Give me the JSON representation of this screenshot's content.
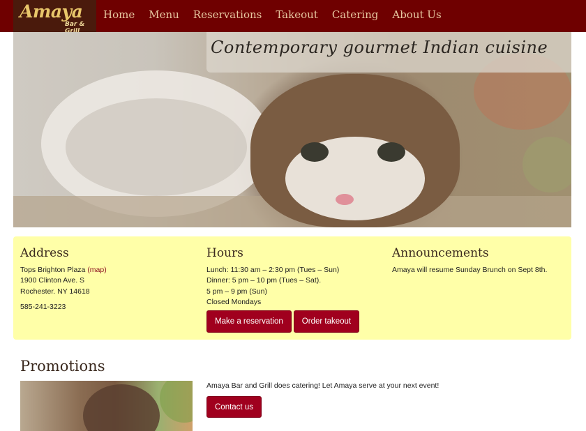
{
  "brand": {
    "name": "Amaya",
    "sub": "Bar & Grill"
  },
  "nav": {
    "items": [
      "Home",
      "Menu",
      "Reservations",
      "Takeout",
      "Catering",
      "About Us"
    ]
  },
  "hero": {
    "tagline": "Contemporary gourmet Indian cuisine"
  },
  "address": {
    "title": "Address",
    "line1": "Tops Brighton Plaza ",
    "map_link": "(map)",
    "line2": "1900 Clinton Ave. S",
    "line3": "Rochester. NY 14618",
    "phone": "585-241-3223"
  },
  "hours": {
    "title": "Hours",
    "lines": [
      "Lunch: 11:30 am – 2:30 pm (Tues – Sun)",
      "Dinner: 5 pm – 10 pm (Tues – Sat).",
      "5 pm – 9 pm (Sun)",
      "Closed Mondays"
    ],
    "reserve_label": "Make a reservation",
    "takeout_label": "Order takeout"
  },
  "announcements": {
    "title": "Announcements",
    "text": "Amaya will resume Sunday Brunch on Sept 8th."
  },
  "promotions": {
    "title": "Promotions",
    "text": "Amaya Bar and Grill does catering! Let Amaya serve at your next event!",
    "contact_label": "Contact us"
  },
  "colors": {
    "navbar": "#6f0000",
    "info_bg": "#ffffa8",
    "button": "#a0001e"
  }
}
